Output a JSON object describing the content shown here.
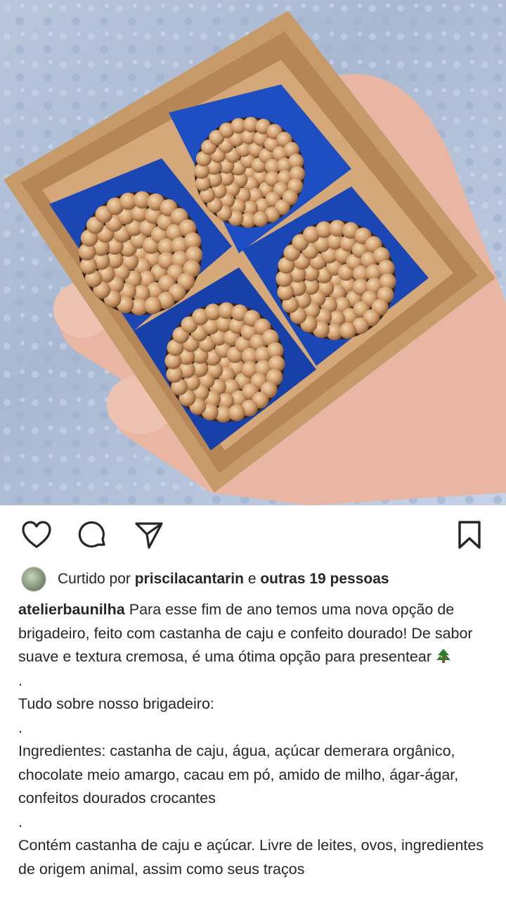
{
  "post": {
    "image_alt": "Caixa com quatro brigadeiros de castanha de caju com confeito dourado"
  },
  "actions": {
    "like_icon": "heart-icon",
    "comment_icon": "comment-icon",
    "share_icon": "send-icon",
    "save_icon": "bookmark-icon"
  },
  "likes": {
    "prefix": "Curtido por",
    "user": "priscilacantarin",
    "conj": "e",
    "others": "outras 19 pessoas"
  },
  "caption": {
    "username": "atelierbaunilha",
    "text_first": "Para esse fim de ano temos uma nova opção de brigadeiro, feito com castanha de caju e confeito dourado! De sabor suave e textura cremosa, é uma ótima opção para presentear",
    "emoji": "tree-emoji",
    "dot1": ".",
    "line2": "Tudo sobre nosso brigadeiro:",
    "dot2": ".",
    "line3": "Ingredientes: castanha de caju, água, açúcar demerara orgânico, chocolate meio amargo, cacau em pó, amido de milho, ágar-ágar, confeitos dourados crocantes",
    "dot3": ".",
    "line4": "Contém castanha de caju e açúcar. Livre de leites, ovos, ingredientes de origem animal, assim como seus traços"
  },
  "colors": {
    "text": "#262626",
    "box": "#c79a6a",
    "cup": "#1b47b5",
    "wall": "#b9c6dc"
  }
}
